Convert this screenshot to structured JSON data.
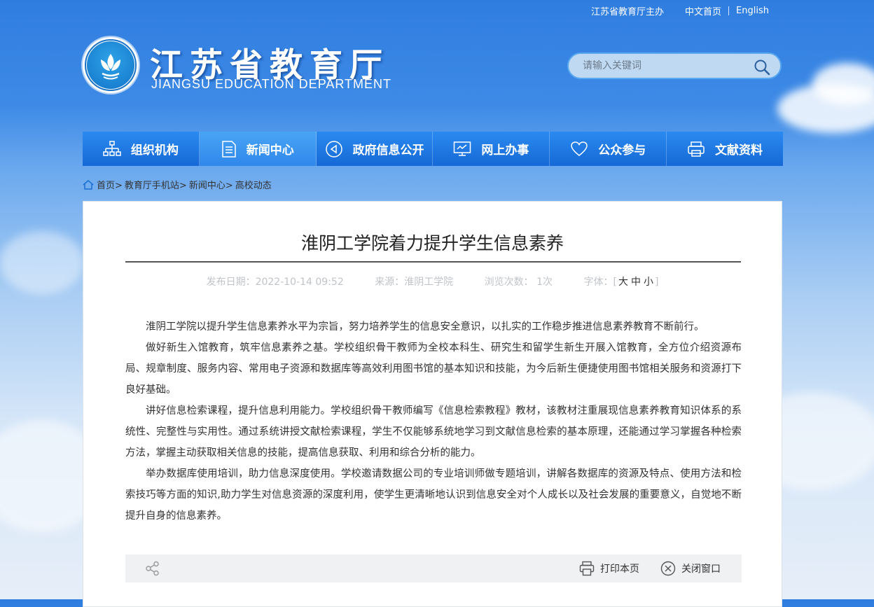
{
  "top_links": {
    "host": "江苏省教育厅主办",
    "home_cn": "中文首页",
    "english": "English"
  },
  "site": {
    "title": "江苏省教育厅",
    "subtitle": "JIANGSU EDUCATION DEPARTMENT"
  },
  "search": {
    "placeholder": "请输入关键词"
  },
  "nav": {
    "items": [
      {
        "label": "组织机构",
        "icon": "org-chart-icon"
      },
      {
        "label": "新闻中心",
        "icon": "document-icon",
        "active": true
      },
      {
        "label": "政府信息公开",
        "icon": "announcement-icon"
      },
      {
        "label": "网上办事",
        "icon": "monitor-icon"
      },
      {
        "label": "公众参与",
        "icon": "heart-icon"
      },
      {
        "label": "文献资料",
        "icon": "printer-icon"
      }
    ]
  },
  "breadcrumb": [
    "首页>",
    "教育厅手机站>",
    "新闻中心>",
    "高校动态"
  ],
  "article": {
    "title": "淮阴工学院着力提升学生信息素养",
    "meta": {
      "date": "发布日期：2022-10-14 09:52",
      "source": "来源：淮阴工学院",
      "views": "浏览次数： 1次",
      "font_label": "字体：",
      "font_sizes": [
        "大",
        "中",
        "小"
      ]
    },
    "paragraphs": [
      "淮阴工学院以提升学生信息素养水平为宗旨，努力培养学生的信息安全意识，以扎实的工作稳步推进信息素养教育不断前行。",
      "做好新生入馆教育，筑牢信息素养之基。学校组织骨干教师为全校本科生、研究生和留学生新生开展入馆教育，全方位介绍资源布局、规章制度、服务内容、常用电子资源和数据库等高效利用图书馆的基本知识和技能，为今后新生便捷使用图书馆相关服务和资源打下良好基础。",
      "讲好信息检索课程，提升信息利用能力。学校组织骨干教师编写《信息检索教程》教材，该教材注重展现信息素养教育知识体系的系统性、完整性与实用性。通过系统讲授文献检索课程，学生不仅能够系统地学习到文献信息检索的基本原理，还能通过学习掌握各种检索方法，掌握主动获取相关信息的技能，提高信息获取、利用和综合分析的能力。",
      "举办数据库使用培训，助力信息深度使用。学校邀请数据公司的专业培训师做专题培训，讲解各数据库的资源及特点、使用方法和检索技巧等方面的知识,助力学生对信息资源的深度利用，使学生更清晰地认识到信息安全对个人成长以及社会发展的重要意义，自觉地不断提升自身的信息素养。"
    ]
  },
  "footer": {
    "print": "打印本页",
    "close": "关闭窗口"
  }
}
